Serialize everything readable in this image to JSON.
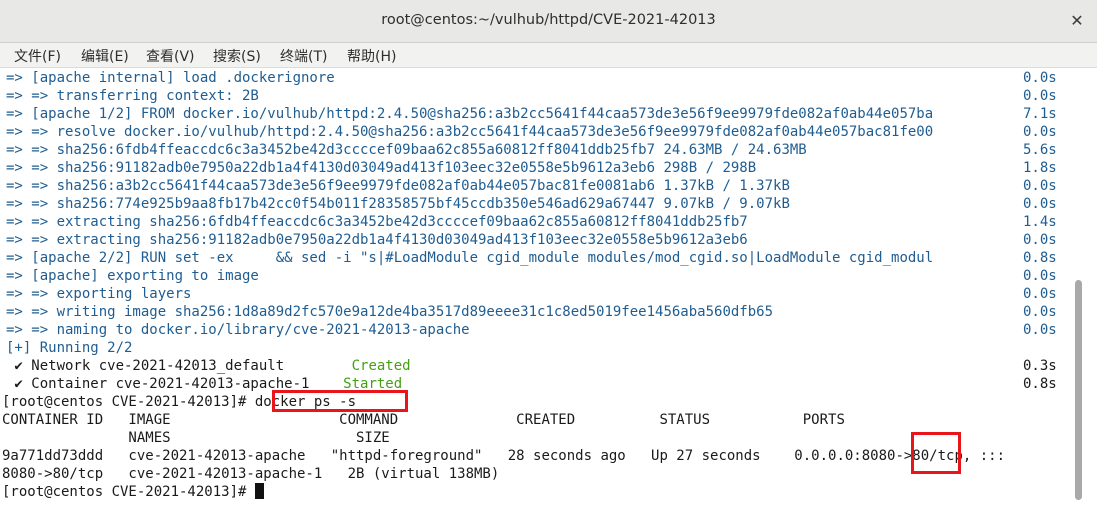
{
  "window": {
    "title": "root@centos:~/vulhub/httpd/CVE-2021-42013",
    "close_glyph": "✕"
  },
  "menu": [
    "文件(F)",
    "编辑(E)",
    "查看(V)",
    "搜索(S)",
    "终端(T)",
    "帮助(H)"
  ],
  "terminal": {
    "build_steps": [
      {
        "text": "=> [apache internal] load .dockerignore",
        "time": "0.0s"
      },
      {
        "text": "=> => transferring context: 2B",
        "time": "0.0s"
      },
      {
        "text": "=> [apache 1/2] FROM docker.io/vulhub/httpd:2.4.50@sha256:a3b2cc5641f44caa573de3e56f9ee9979fde082af0ab44e057ba",
        "time": "7.1s"
      },
      {
        "text": "=> => resolve docker.io/vulhub/httpd:2.4.50@sha256:a3b2cc5641f44caa573de3e56f9ee9979fde082af0ab44e057bac81fe00",
        "time": "0.0s"
      },
      {
        "text": "=> => sha256:6fdb4ffeaccdc6c3a3452be42d3ccccef09baa62c855a60812ff8041ddb25fb7 24.63MB / 24.63MB",
        "time": "5.6s"
      },
      {
        "text": "=> => sha256:91182adb0e7950a22db1a4f4130d03049ad413f103eec32e0558e5b9612a3eb6 298B / 298B",
        "time": "1.8s"
      },
      {
        "text": "=> => sha256:a3b2cc5641f44caa573de3e56f9ee9979fde082af0ab44e057bac81fe0081ab6 1.37kB / 1.37kB",
        "time": "0.0s"
      },
      {
        "text": "=> => sha256:774e925b9aa8fb17b42cc0f54b011f28358575bf45ccdb350e546ad629a67447 9.07kB / 9.07kB",
        "time": "0.0s"
      },
      {
        "text": "=> => extracting sha256:6fdb4ffeaccdc6c3a3452be42d3ccccef09baa62c855a60812ff8041ddb25fb7",
        "time": "1.4s"
      },
      {
        "text": "=> => extracting sha256:91182adb0e7950a22db1a4f4130d03049ad413f103eec32e0558e5b9612a3eb6",
        "time": "0.0s"
      },
      {
        "text": "=> [apache 2/2] RUN set -ex     && sed -i \"s|#LoadModule cgid_module modules/mod_cgid.so|LoadModule cgid_modul",
        "time": "0.8s"
      },
      {
        "text": "=> [apache] exporting to image",
        "time": "0.0s"
      },
      {
        "text": "=> => exporting layers",
        "time": "0.0s"
      },
      {
        "text": "=> => writing image sha256:1d8a89d2fc570e9a12de4ba3517d89eeee31c1c8ed5019fee1456aba560dfb65",
        "time": "0.0s"
      },
      {
        "text": "=> => naming to docker.io/library/cve-2021-42013-apache",
        "time": "0.0s"
      }
    ],
    "running": "[+] Running 2/2",
    "network_line": {
      "prefix": " ✔ Network cve-2021-42013_default",
      "status": "Created",
      "time": "0.3s"
    },
    "container_line": {
      "prefix": " ✔ Container cve-2021-42013-apache-1",
      "status": "Started",
      "time": "0.8s"
    },
    "prompt": "[root@centos CVE-2021-42013]# ",
    "command": "docker ps -s",
    "table_header_1": "CONTAINER ID   IMAGE                    COMMAND              CREATED          STATUS           PORTS",
    "table_header_2": "               NAMES                      SIZE",
    "row_1": "9a771dd73ddd   cve-2021-42013-apache   \"httpd-foreground\"   28 seconds ago   Up 27 seconds    0.0.0.0:8080->80/tcp, :::",
    "row_2": "8080->80/tcp   cve-2021-42013-apache-1   2B (virtual 138MB)",
    "final_prompt": "[root@centos CVE-2021-42013]# "
  }
}
